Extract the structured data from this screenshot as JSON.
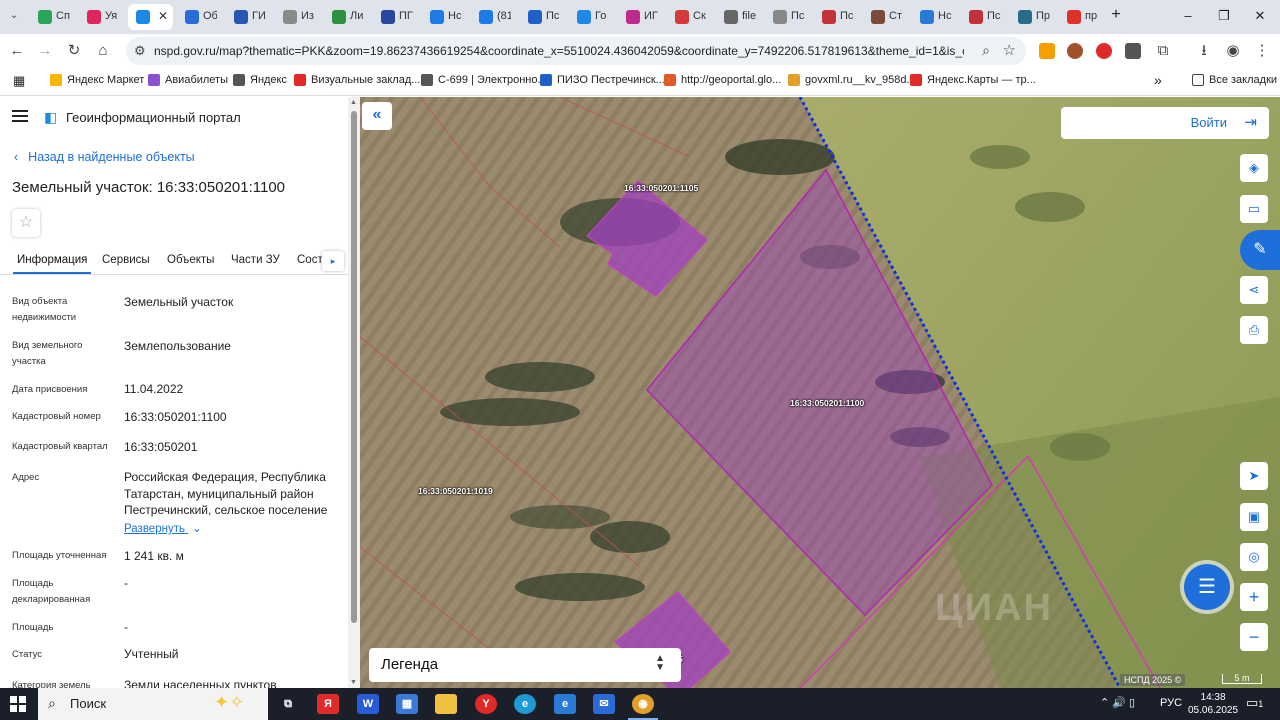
{
  "browser": {
    "tabs": [
      {
        "label": "Сп",
        "color": "#2ca35b"
      },
      {
        "label": "Уя",
        "color": "#e0245e"
      },
      {
        "label": "",
        "color": "#1e88e5",
        "active": true
      },
      {
        "label": "Об",
        "color": "#2a6bd6"
      },
      {
        "label": "ГИ",
        "color": "#2a56b3"
      },
      {
        "label": "Из",
        "color": "#8a8a8a"
      },
      {
        "label": "Ли",
        "color": "#2f8f43"
      },
      {
        "label": "ПГ",
        "color": "#2848a0"
      },
      {
        "label": "Нс",
        "color": "#1e7be6"
      },
      {
        "label": "(81",
        "color": "#1e7be6"
      },
      {
        "label": "Пс",
        "color": "#1e60c8"
      },
      {
        "label": "Го",
        "color": "#1e88e5"
      },
      {
        "label": "ИГ",
        "color": "#c02a8c"
      },
      {
        "label": "Ск",
        "color": "#d43a3a"
      },
      {
        "label": "file",
        "color": "#666666"
      },
      {
        "label": "Пс",
        "color": "#888888"
      },
      {
        "label": "Пс",
        "color": "#c3323a"
      },
      {
        "label": "Ст",
        "color": "#7a4a3a"
      },
      {
        "label": "Нс",
        "color": "#2a7bd6"
      },
      {
        "label": "Пс",
        "color": "#c3323a"
      },
      {
        "label": "Пр",
        "color": "#2a6b8a"
      },
      {
        "label": "пр",
        "color": "#e0302a"
      }
    ],
    "new_tab": "+",
    "url": "nspd.gov.ru/map?thematic=PKK&zoom=19.86237436619254&coordinate_x=5510024.436042059&coordinate_y=7492206.517819613&theme_id=1&is_copy_url=...",
    "bookmarks": [
      {
        "label": "Яндекс Маркет",
        "color": "#f5b800"
      },
      {
        "label": "Авиабилеты",
        "color": "#8a4fd6"
      },
      {
        "label": "Яндекс",
        "color": "#555555"
      },
      {
        "label": "Визуальные заклад...",
        "color": "#e02a2a"
      },
      {
        "label": "С-699 | Электронно...",
        "color": "#555555"
      },
      {
        "label": "ПИЗО Пестречинск...",
        "color": "#1e60c8"
      },
      {
        "label": "http://geoportal.glo...",
        "color": "#e05a2a"
      },
      {
        "label": "govxml.ru__kv_958d...",
        "color": "#e0a02a"
      },
      {
        "label": "Яндекс.Карты — тр...",
        "color": "#e02a2a"
      }
    ],
    "bookmarks_more": "»",
    "all_bookmarks": "Все закладки"
  },
  "panel": {
    "portal_title": "Геоинформационный портал",
    "back_link": "Назад в найденные объекты",
    "page_title": "Земельный участок: 16:33:050201:1100",
    "tabs": [
      "Информация",
      "Сервисы",
      "Объекты",
      "Части ЗУ",
      "Соста"
    ],
    "fields": [
      {
        "label": "Вид объекта недвижимости",
        "value": "Земельный участок"
      },
      {
        "label": "Вид земельного участка",
        "value": "Землепользование"
      },
      {
        "label": "Дата присвоения",
        "value": "11.04.2022"
      },
      {
        "label": "Кадастровый номер",
        "value": "16:33:050201:1100"
      },
      {
        "label": "Кадастровый квартал",
        "value": "16:33:050201"
      },
      {
        "label": "Адрес",
        "value": "Российская Федерация, Республика Татарстан, муниципальный район Пестречинский, сельское поселение"
      },
      {
        "label": "Площадь уточненная",
        "value": "1 241 кв. м"
      },
      {
        "label": "Площадь декларированная",
        "value": "-"
      },
      {
        "label": "Площадь",
        "value": "-"
      },
      {
        "label": "Статус",
        "value": "Учтенный"
      },
      {
        "label": "Категория земель",
        "value": "Земли населенных пунктов"
      }
    ],
    "expand_link": "Развернуть"
  },
  "map": {
    "login_label": "Войти",
    "legend_label": "Легенда",
    "parcel_labels": [
      "16:33:050201:1105",
      "16:33:050201:1100",
      "16:33:050201:1019",
      "5"
    ],
    "watermark": "ЦИАН",
    "copyright": "НСПД 2025 ©",
    "scale": "5 m"
  },
  "taskbar": {
    "search_label": "Поиск",
    "lang": "РУС",
    "time": "14:38",
    "date": "05.06.2025",
    "notifications": "1"
  }
}
